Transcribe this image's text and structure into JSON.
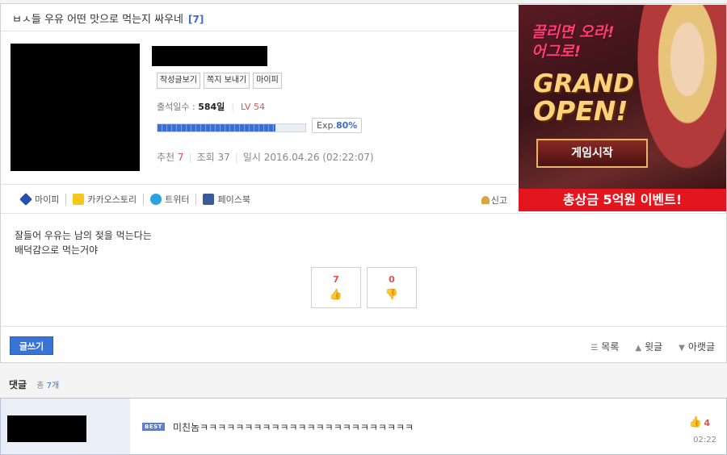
{
  "post": {
    "title": "ㅂㅅ들 우유 어떤 맛으로 먹는지 싸우네",
    "comment_count_label": "[7]",
    "buttons": {
      "posts": "작성글보기",
      "message": "쪽지 보내기",
      "mypi": "마이피"
    },
    "attendance_label": "출석일수 :",
    "attendance_value": "584일",
    "level": "LV 54",
    "exp_prefix": "Exp.",
    "exp_value": "80%",
    "exp_fraction": 0.8,
    "stats": {
      "recommend_label": "추천",
      "recommend_value": "7",
      "views_label": "조회",
      "views_value": "37",
      "date_label": "일시",
      "date_value": "2016.04.26 (02:22:07)"
    },
    "share": {
      "mypi": "마이피",
      "kakao": "카카오스토리",
      "twitter": "트위터",
      "facebook": "페이스북",
      "report": "신고"
    },
    "content_lines": [
      "잘들어 우유는 남의 젖을 먹는다는",
      "배덕감으로 먹는거야"
    ],
    "votes": {
      "up": "7",
      "down": "0"
    },
    "actions": {
      "write": "글쓰기",
      "list": "목록",
      "prev": "윗글",
      "next": "아랫글"
    }
  },
  "ad": {
    "slogan_line1": "끌리면 오라!",
    "slogan_line2": "어그로!",
    "grand": "GRAND",
    "open": "OPEN!",
    "start_button": "게임시작",
    "event_text": "총상금 5억원 이벤트!"
  },
  "comments": {
    "header": "댓글",
    "count_prefix": "총",
    "count_value": "7개",
    "items": [
      {
        "badge": "BEST",
        "text": "미친놈ㅋㅋㅋㅋㅋㅋㅋㅋㅋㅋㅋㅋㅋㅋㅋㅋㅋㅋㅋㅋㅋㅋㅋㅋ",
        "likes": "4",
        "time": "02:22"
      }
    ]
  }
}
